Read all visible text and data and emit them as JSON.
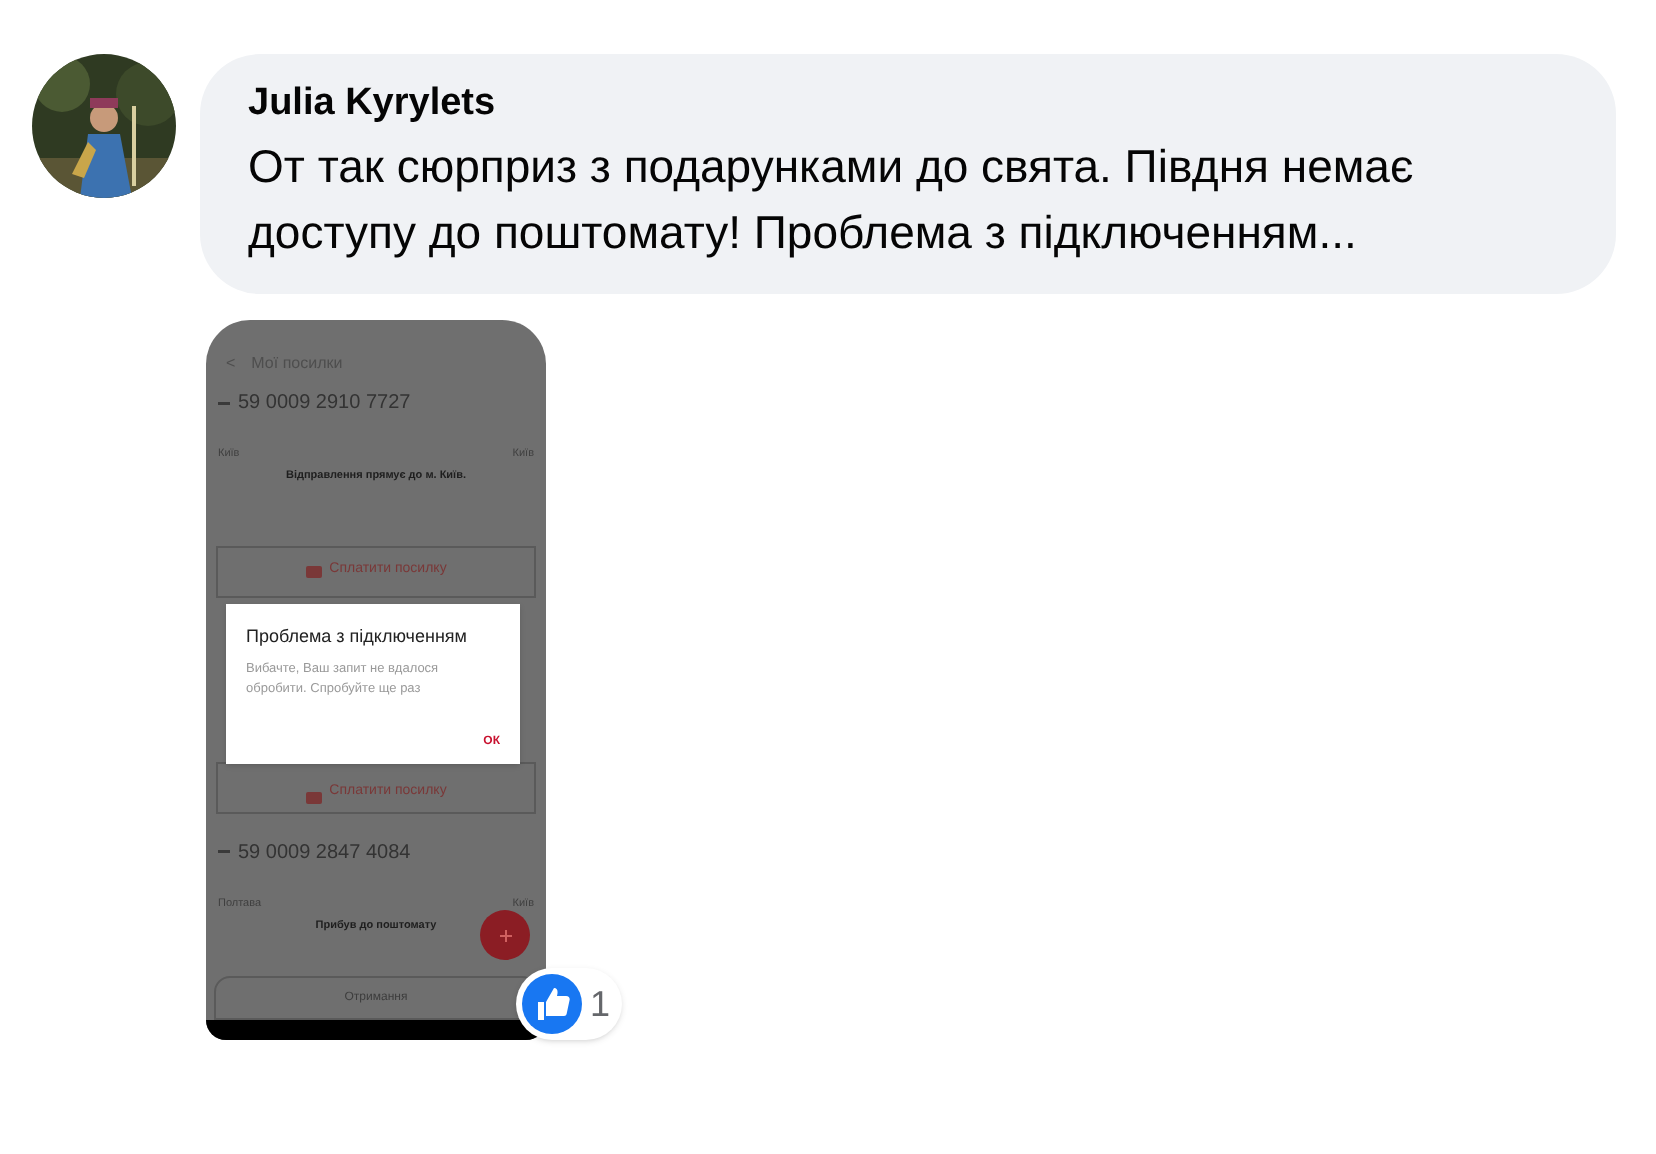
{
  "comment": {
    "author": "Julia Kyrylets",
    "text": "От так сюрприз з подарунками до свята. Півдня немає доступу до поштомату! Проблема з підключенням..."
  },
  "attachment": {
    "header": {
      "back": "<",
      "title": "Мої посилки"
    },
    "parcels": [
      {
        "number": "59 0009 2910 7727",
        "from": "Київ",
        "to": "Київ",
        "status": "Відправлення прямує до м. Київ.",
        "action": "Сплатити посилку"
      },
      {
        "number": "59 0009 2847 4084",
        "from": "Полтава",
        "to": "Київ",
        "status": "Прибув до поштомату"
      }
    ],
    "second_action": "Сплатити посилку",
    "bottom_label": "Отримання",
    "dialog": {
      "title": "Проблема з підключенням",
      "message": "Вибачте, Ваш запит не вдалося обробити. Спробуйте ще раз",
      "button": "ОК"
    }
  },
  "reactions": {
    "count": "1"
  }
}
